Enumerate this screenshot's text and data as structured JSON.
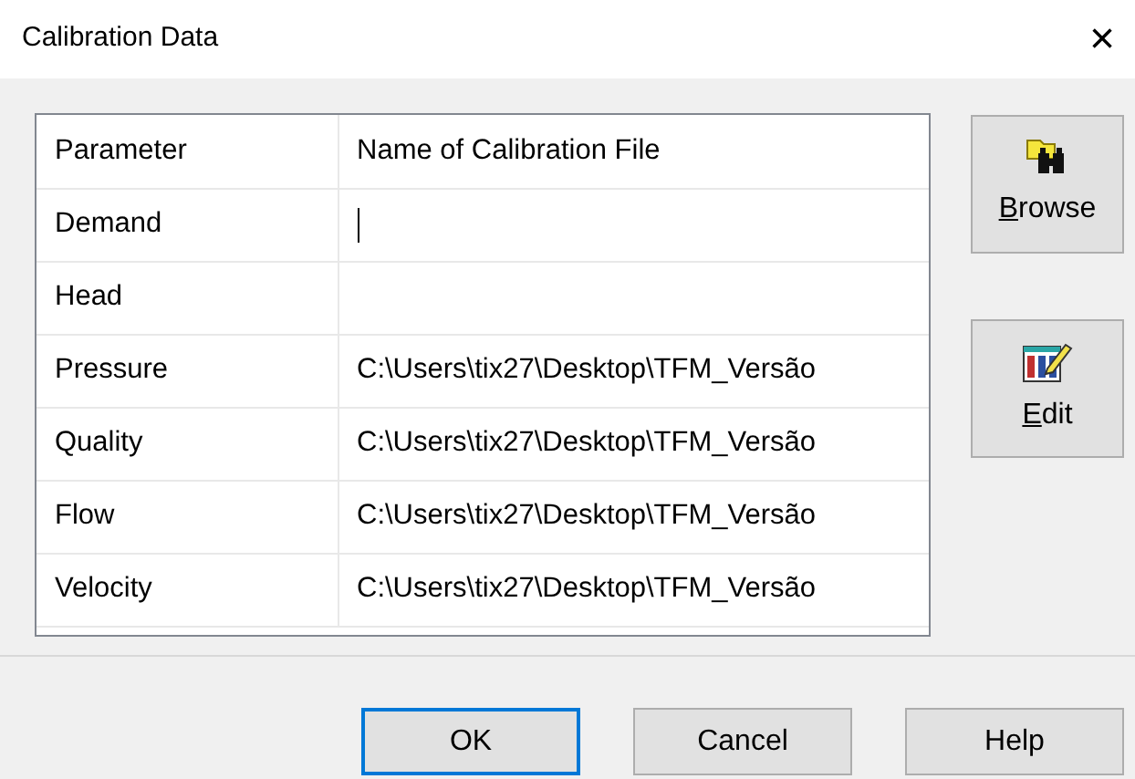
{
  "window": {
    "title": "Calibration Data",
    "close": "×"
  },
  "table": {
    "columns": [
      "Parameter",
      "Name of Calibration File"
    ],
    "rows": [
      {
        "parameter": "Demand",
        "file": "",
        "editing": true
      },
      {
        "parameter": "Head",
        "file": "",
        "editing": false
      },
      {
        "parameter": "Pressure",
        "file": "C:\\Users\\tix27\\Desktop\\TFM_Versão",
        "editing": false
      },
      {
        "parameter": "Quality",
        "file": "C:\\Users\\tix27\\Desktop\\TFM_Versão",
        "editing": false
      },
      {
        "parameter": "Flow",
        "file": "C:\\Users\\tix27\\Desktop\\TFM_Versão",
        "editing": false
      },
      {
        "parameter": "Velocity",
        "file": "C:\\Users\\tix27\\Desktop\\TFM_Versão",
        "editing": false
      }
    ]
  },
  "side_buttons": [
    {
      "label": "Browse",
      "kind": "browse",
      "underline_first": true
    },
    {
      "label": "Edit",
      "kind": "edit",
      "underline_first": true
    }
  ],
  "buttons": [
    {
      "label": "OK",
      "default": true
    },
    {
      "label": "Cancel",
      "default": false
    },
    {
      "label": "Help",
      "default": false
    }
  ]
}
